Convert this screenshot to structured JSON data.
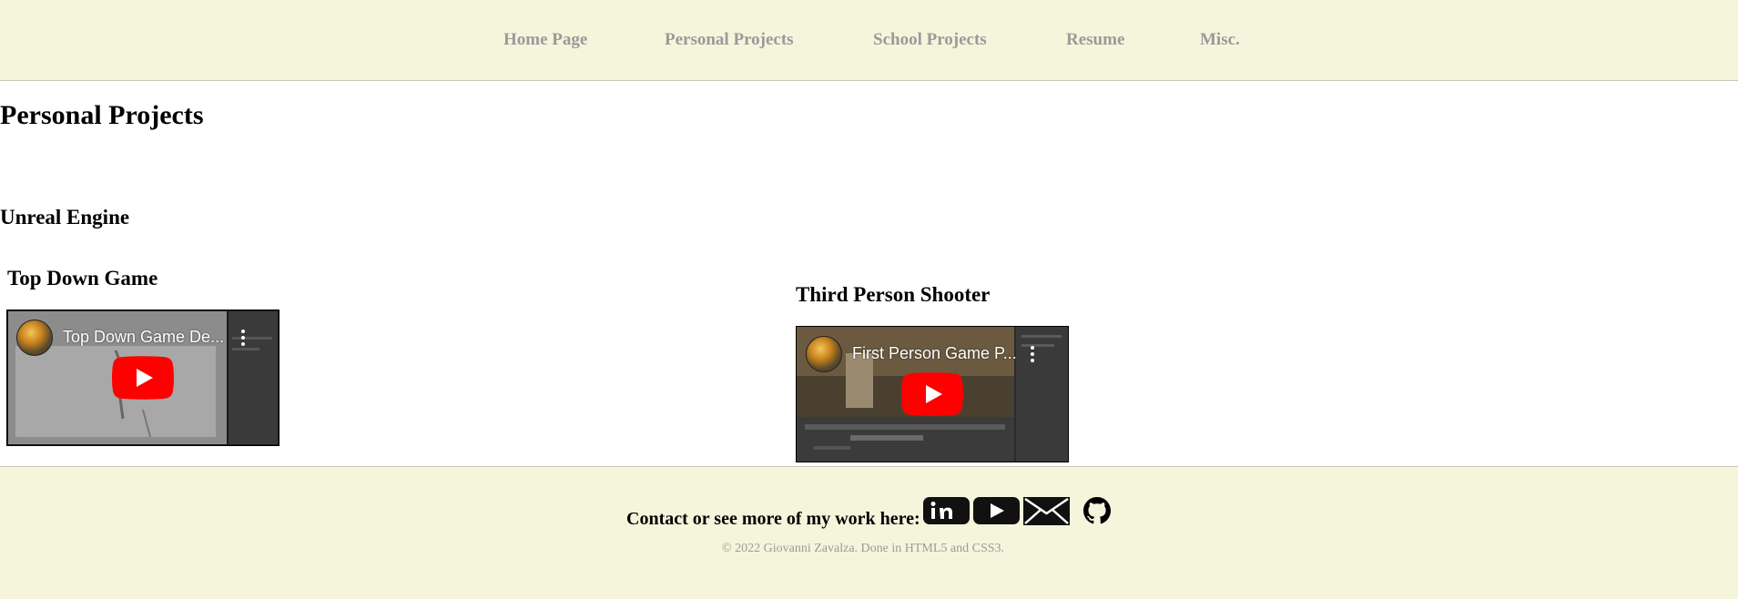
{
  "nav": {
    "items": [
      {
        "label": "Home Page"
      },
      {
        "label": "Personal Projects"
      },
      {
        "label": "School Projects"
      },
      {
        "label": "Resume"
      },
      {
        "label": "Misc."
      }
    ]
  },
  "main": {
    "title": "Personal Projects",
    "section_title": "Unreal Engine",
    "projects": [
      {
        "title": "Top Down Game",
        "video_title": "Top Down Game De..."
      },
      {
        "title": "Third Person Shooter",
        "video_title": "First Person Game P..."
      }
    ]
  },
  "footer": {
    "contact_text": "Contact or see more of my work here:",
    "icons": [
      "linkedin-icon",
      "youtube-icon",
      "email-icon",
      "github-icon"
    ],
    "copyright": "© 2022 Giovanni Zavalza. Done in HTML5 and CSS3."
  },
  "colors": {
    "header_bg": "#f5f5dc",
    "nav_link": "#9a9a9a",
    "youtube_red": "#ff0000"
  }
}
